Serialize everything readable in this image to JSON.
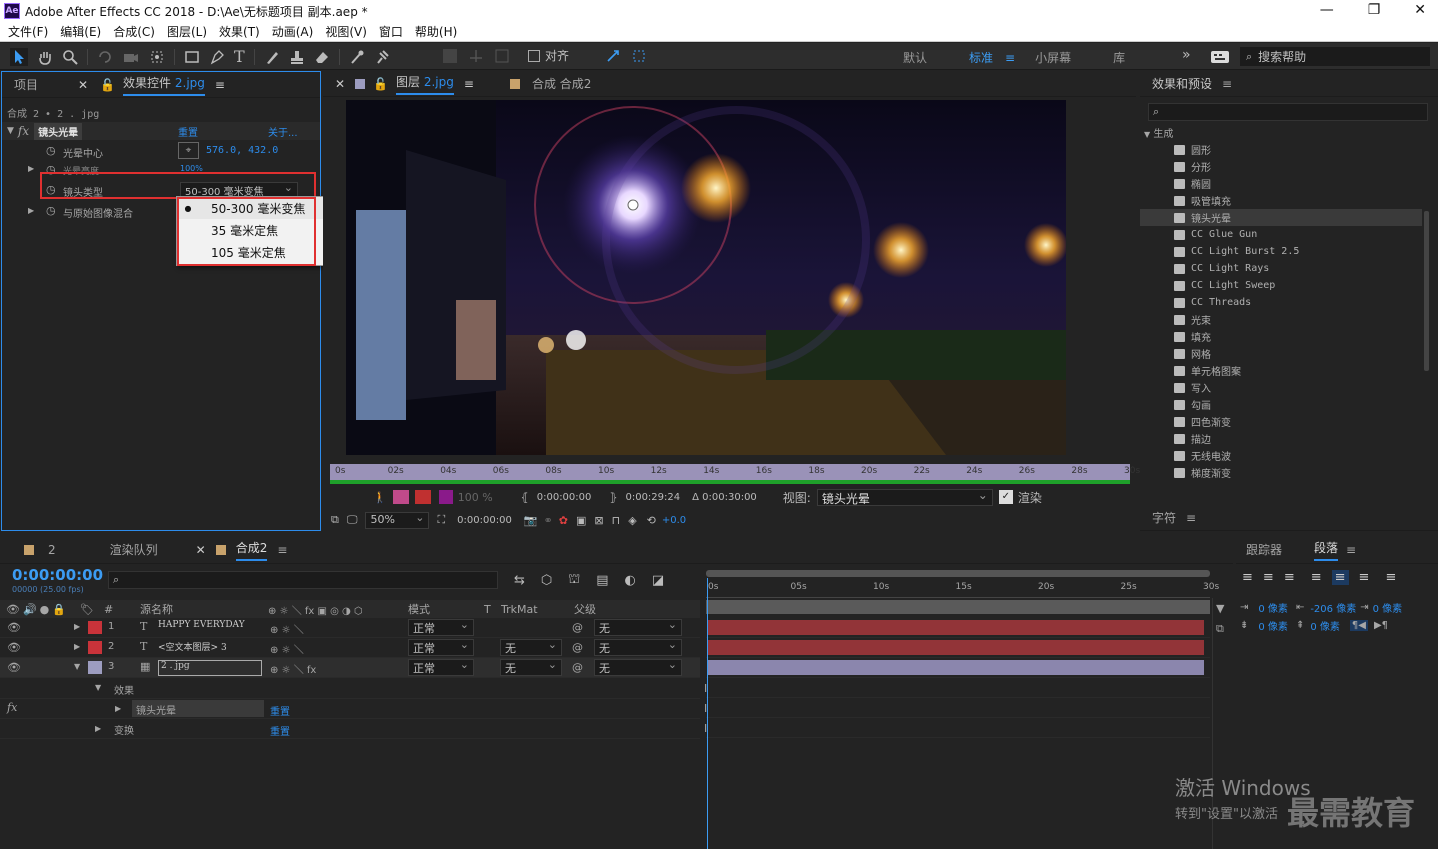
{
  "app": {
    "title": "Adobe After Effects CC 2018 - D:\\Ae\\无标题项目 副本.aep *",
    "icon": "Ae"
  },
  "menu": [
    "文件(F)",
    "编辑(E)",
    "合成(C)",
    "图层(L)",
    "效果(T)",
    "动画(A)",
    "视图(V)",
    "窗口",
    "帮助(H)"
  ],
  "toolbar": {
    "snap_label": "对齐",
    "workspaces": [
      "默认",
      "标准",
      "小屏幕",
      "库"
    ],
    "active_workspace": "标准",
    "search_placeholder": "搜索帮助"
  },
  "left_panel": {
    "tab_project": "项目",
    "tab_effects": "效果控件",
    "tab_effects_file": "2.jpg",
    "breadcrumb": "合成 2 • 2 . jpg",
    "effect_name": "镜头光晕",
    "reset": "重置",
    "about": "关于...",
    "props": [
      {
        "label": "光晕中心",
        "value": "576.0, 432.0"
      },
      {
        "label": "光晕亮度",
        "value": "100%"
      },
      {
        "label": "镜头类型",
        "value": "50-300 毫米变焦"
      },
      {
        "label": "与原始图像混合",
        "value": ""
      }
    ],
    "dropdown_options": [
      "50-300 毫米变焦",
      "35 毫米定焦",
      "105 毫米定焦"
    ],
    "selected_option": "50-300 毫米变焦"
  },
  "viewer": {
    "tab_layer": "图层",
    "tab_layer_file": "2.jpg",
    "tab_comp": "合成 合成2",
    "ruler": [
      "0s",
      "02s",
      "04s",
      "06s",
      "08s",
      "10s",
      "12s",
      "14s",
      "16s",
      "18s",
      "20s",
      "22s",
      "24s",
      "26s",
      "28s",
      "30s"
    ],
    "opacity": "100 %",
    "in_time": "0:00:00:00",
    "out_time": "0:00:29:24",
    "duration": "Δ 0:00:30:00",
    "view_label": "视图:",
    "view_value": "镜头光晕",
    "render_label": "渲染",
    "zoom": "50%",
    "current_time": "0:00:00:00",
    "exposure": "+0.0"
  },
  "right_panel": {
    "title": "效果和预设",
    "category": "生成",
    "items": [
      "圆形",
      "分形",
      "椭圆",
      "吸管填充",
      "镜头光晕",
      "CC Glue Gun",
      "CC Light Burst 2.5",
      "CC Light Rays",
      "CC Light Sweep",
      "CC Threads",
      "光束",
      "填充",
      "网格",
      "单元格图案",
      "写入",
      "勾画",
      "四色渐变",
      "描边",
      "无线电波",
      "梯度渐变"
    ],
    "selected": "镜头光晕",
    "char_tab": "字符"
  },
  "timeline": {
    "tab_2": "2",
    "tab_render": "渲染队列",
    "tab_comp": "合成2",
    "timecode": "0:00:00:00",
    "fps": "00000 (25.00 fps)",
    "col_name": "源名称",
    "col_mode": "模式",
    "col_t": "T",
    "col_trkmat": "TrkMat",
    "col_parent": "父级",
    "ruler": [
      "0s",
      "05s",
      "10s",
      "15s",
      "20s",
      "25s",
      "30s"
    ],
    "layers": [
      {
        "num": "1",
        "type": "T",
        "name": "HAPPY EVERYDAY",
        "mode": "正常",
        "trk": "",
        "parent": "无",
        "color": "#c9333a"
      },
      {
        "num": "2",
        "type": "T",
        "name": "<空文本图层> 3",
        "mode": "正常",
        "trk": "无",
        "parent": "无",
        "color": "#c9333a"
      },
      {
        "num": "3",
        "type": "img",
        "name": "2 . jpg",
        "mode": "正常",
        "trk": "无",
        "parent": "无",
        "color": "#9d9dc0"
      }
    ],
    "sub_effects": "效果",
    "sub_effect_name": "镜头光晕",
    "sub_reset": "重置",
    "sub_transform": "变换",
    "sub_transform_reset": "重置"
  },
  "para_panel": {
    "tab_tracker": "跟踪器",
    "tab_para": "段落",
    "indent_values": [
      "0 像素",
      "-206 像素",
      "0 像素",
      "0 像素",
      "0 像素"
    ]
  },
  "watermark": {
    "activate": "激活 Windows",
    "goto": "转到\"设置\"以激活",
    "logo": "最需教育"
  }
}
